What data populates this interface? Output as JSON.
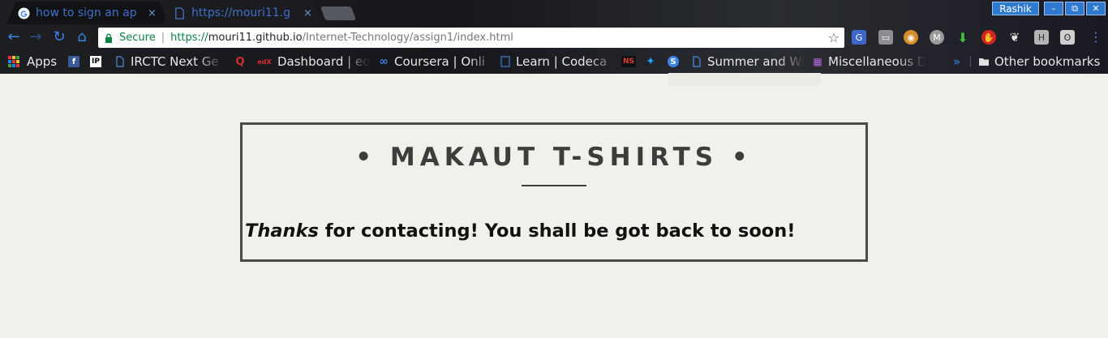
{
  "browser": {
    "tabs": [
      {
        "title": "how to sign an ap",
        "close": "×"
      },
      {
        "title": "https://mouri11.g",
        "close": "×"
      }
    ],
    "profile_name": "Rashik",
    "window_buttons": {
      "minimize": "–",
      "restore": "⧉",
      "close": "✕"
    },
    "toolbar": {
      "back": "←",
      "forward": "→",
      "reload": "↻",
      "home": "⌂"
    },
    "omnibox": {
      "secure_label": "Secure",
      "separator": "|",
      "scheme": "https://",
      "host": "mouri11.github.io",
      "path": "/Internet-Technology/assign1/index.html",
      "star": "☆"
    },
    "extensions": {
      "translate": "G",
      "chat": "▭",
      "face": "◉",
      "m": "M",
      "down": "⬇",
      "stop": "✋",
      "paw": "❦",
      "h": "H",
      "face2": "ʘ",
      "menu": "⋮"
    },
    "bookmarks": [
      {
        "label": "Apps"
      },
      {
        "label": "",
        "icon_text": "f"
      },
      {
        "label": "",
        "icon_text": "IP"
      },
      {
        "label": "IRCTC Next Ge"
      },
      {
        "label": "",
        "icon_text": "Q"
      },
      {
        "label": "Dashboard | ed",
        "icon_text": "edX"
      },
      {
        "label": "Coursera | Onli",
        "icon_text": "∞"
      },
      {
        "label": "Learn | Codeca"
      },
      {
        "label": "",
        "icon_text": "NS"
      },
      {
        "label": "",
        "icon_text": "✦"
      },
      {
        "label": "",
        "icon_text": "S"
      },
      {
        "label": "Summer and Wi"
      },
      {
        "label": "Miscellaneous D"
      },
      {
        "label": "Other bookmarks"
      }
    ],
    "bookmarks_more": "»"
  },
  "page": {
    "title": "• MAKAUT T-SHIRTS •",
    "message_emphasis": "Thanks",
    "message_rest": " for contacting! You shall be got back to soon!"
  }
}
